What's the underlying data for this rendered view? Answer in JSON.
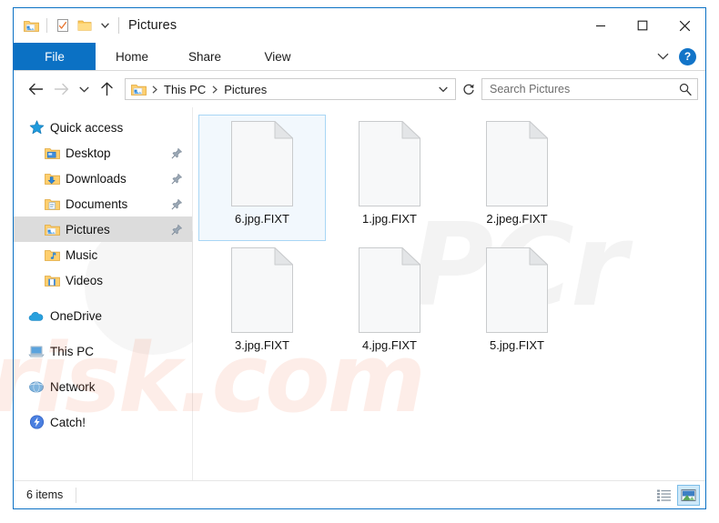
{
  "window": {
    "title": "Pictures",
    "quick_access_toolbar": [
      {
        "name": "pictures-folder-icon",
        "label": "Pictures folder"
      },
      {
        "name": "properties-icon",
        "label": "Properties"
      },
      {
        "name": "new-folder-icon",
        "label": "New folder"
      },
      {
        "name": "customize-chevron-icon",
        "label": "Customize Quick Access Toolbar"
      }
    ],
    "controls": {
      "minimize": "Minimize",
      "maximize": "Maximize",
      "close": "Close"
    }
  },
  "ribbon": {
    "tabs": [
      {
        "label": "File",
        "active": true
      },
      {
        "label": "Home",
        "active": false
      },
      {
        "label": "Share",
        "active": false
      },
      {
        "label": "View",
        "active": false
      }
    ],
    "expand_label": "Expand the Ribbon",
    "help_label": "?"
  },
  "address": {
    "back": "Back",
    "forward": "Forward",
    "recent": "Recent locations",
    "up": "Up",
    "breadcrumbs": [
      "This PC",
      "Pictures"
    ],
    "dropdown": "Previous locations",
    "refresh": "Refresh"
  },
  "search": {
    "placeholder": "Search Pictures",
    "value": "Search Pictures",
    "icon": "search-icon"
  },
  "sidebar": {
    "groups": [
      {
        "header": {
          "label": "Quick access",
          "icon": "star-icon"
        },
        "items": [
          {
            "label": "Desktop",
            "icon": "desktop-folder-icon",
            "pinned": true,
            "selected": false
          },
          {
            "label": "Downloads",
            "icon": "downloads-folder-icon",
            "pinned": true,
            "selected": false
          },
          {
            "label": "Documents",
            "icon": "documents-folder-icon",
            "pinned": true,
            "selected": false
          },
          {
            "label": "Pictures",
            "icon": "pictures-folder-icon",
            "pinned": true,
            "selected": true
          },
          {
            "label": "Music",
            "icon": "music-folder-icon",
            "pinned": false,
            "selected": false
          },
          {
            "label": "Videos",
            "icon": "videos-folder-icon",
            "pinned": false,
            "selected": false
          }
        ]
      },
      {
        "header": null,
        "items": [
          {
            "label": "OneDrive",
            "icon": "onedrive-cloud-icon",
            "pinned": false,
            "selected": false
          }
        ]
      },
      {
        "header": null,
        "items": [
          {
            "label": "This PC",
            "icon": "this-pc-icon",
            "pinned": false,
            "selected": false
          }
        ]
      },
      {
        "header": null,
        "items": [
          {
            "label": "Network",
            "icon": "network-icon",
            "pinned": false,
            "selected": false
          }
        ]
      },
      {
        "header": null,
        "items": [
          {
            "label": "Catch!",
            "icon": "catch-icon",
            "pinned": false,
            "selected": false
          }
        ]
      }
    ]
  },
  "files": [
    {
      "name": "6.jpg.FIXT",
      "icon": "blank-document-icon",
      "selected": true
    },
    {
      "name": "1.jpg.FIXT",
      "icon": "blank-document-icon",
      "selected": false
    },
    {
      "name": "2.jpeg.FIXT",
      "icon": "blank-document-icon",
      "selected": false
    },
    {
      "name": "3.jpg.FIXT",
      "icon": "blank-document-icon",
      "selected": false
    },
    {
      "name": "4.jpg.FIXT",
      "icon": "blank-document-icon",
      "selected": false
    },
    {
      "name": "5.jpg.FIXT",
      "icon": "blank-document-icon",
      "selected": false
    }
  ],
  "status": {
    "item_count": "6 items",
    "views": [
      {
        "name": "details-view",
        "label": "Details view",
        "active": false
      },
      {
        "name": "large-icons-view",
        "label": "Large icons view",
        "active": true
      }
    ]
  },
  "watermark": {
    "top": "PCr",
    "bottom": "risk.com"
  },
  "colors": {
    "accent": "#0b71c4",
    "selection": "#dcdcdc",
    "file_selection": "#f2f8fd",
    "file_selection_border": "#a8d6f5",
    "help_blue": "#1274c8"
  }
}
